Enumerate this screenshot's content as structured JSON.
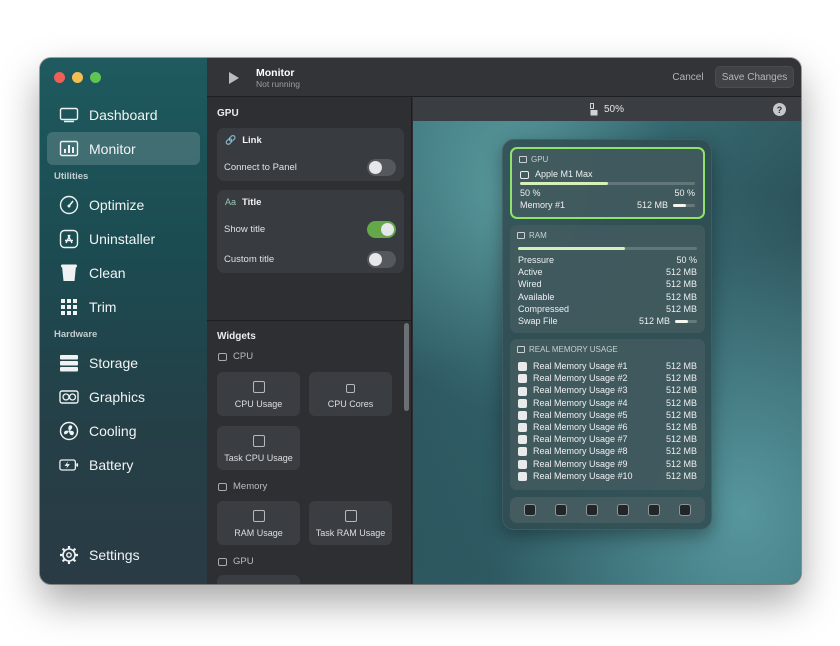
{
  "sidebar": {
    "items": [
      {
        "label": "Dashboard",
        "icon": "display-icon"
      },
      {
        "label": "Monitor",
        "icon": "chart-bars-icon"
      }
    ],
    "utilities_label": "Utilities",
    "utilities": [
      {
        "label": "Optimize",
        "icon": "gauge-icon"
      },
      {
        "label": "Uninstaller",
        "icon": "app-store-icon"
      },
      {
        "label": "Clean",
        "icon": "bin-icon"
      },
      {
        "label": "Trim",
        "icon": "grid-icon"
      }
    ],
    "hardware_label": "Hardware",
    "hardware": [
      {
        "label": "Storage",
        "icon": "storage-icon"
      },
      {
        "label": "Graphics",
        "icon": "gpu-icon"
      },
      {
        "label": "Cooling",
        "icon": "fan-icon"
      },
      {
        "label": "Battery",
        "icon": "battery-icon"
      }
    ],
    "settings": "Settings",
    "active": "Monitor"
  },
  "header": {
    "title": "Monitor",
    "subtitle": "Not running",
    "cancel": "Cancel",
    "save": "Save Changes"
  },
  "config": {
    "section": "GPU",
    "link_card": {
      "title": "Link",
      "row": "Connect to Panel",
      "on": false
    },
    "title_card": {
      "title": "Title",
      "show_title": "Show title",
      "show_on": true,
      "custom_title": "Custom title",
      "custom_on": false
    },
    "widgets_label": "Widgets",
    "cpu_label": "CPU",
    "cpu_tiles": [
      "CPU Usage",
      "CPU Cores",
      "Task CPU Usage"
    ],
    "memory_label": "Memory",
    "memory_tiles": [
      "RAM Usage",
      "Task RAM Usage"
    ],
    "gpu_label": "GPU"
  },
  "preview": {
    "zoom": "50%",
    "gpu_card": {
      "header": "GPU",
      "device": "Apple M1 Max",
      "usage_left": "50 %",
      "usage_right": "50 %",
      "usage_fraction": 0.5,
      "memory_label": "Memory #1",
      "memory_value": "512 MB",
      "memory_fraction": 0.6
    },
    "ram_card": {
      "header": "RAM",
      "bar_fraction": 0.6,
      "rows": [
        {
          "label": "Pressure",
          "value": "50 %"
        },
        {
          "label": "Active",
          "value": "512 MB"
        },
        {
          "label": "Wired",
          "value": "512 MB"
        },
        {
          "label": "Available",
          "value": "512 MB"
        },
        {
          "label": "Compressed",
          "value": "512 MB"
        }
      ],
      "swap_label": "Swap File",
      "swap_value": "512 MB",
      "swap_fraction": 0.6
    },
    "real_card": {
      "header": "REAL MEMORY USAGE",
      "rows": [
        {
          "label": "Real Memory Usage #1",
          "value": "512 MB"
        },
        {
          "label": "Real Memory Usage #2",
          "value": "512 MB"
        },
        {
          "label": "Real Memory Usage #3",
          "value": "512 MB"
        },
        {
          "label": "Real Memory Usage #4",
          "value": "512 MB"
        },
        {
          "label": "Real Memory Usage #5",
          "value": "512 MB"
        },
        {
          "label": "Real Memory Usage #6",
          "value": "512 MB"
        },
        {
          "label": "Real Memory Usage #7",
          "value": "512 MB"
        },
        {
          "label": "Real Memory Usage #8",
          "value": "512 MB"
        },
        {
          "label": "Real Memory Usage #9",
          "value": "512 MB"
        },
        {
          "label": "Real Memory Usage #10",
          "value": "512 MB"
        }
      ]
    },
    "dock_icons": [
      "bolt-icon",
      "terminal-icon",
      "mail-icon",
      "console-icon",
      "lock-icon",
      "gear-icon"
    ]
  },
  "colors": {
    "accent_green": "#8ee36a",
    "toggle_on": "#65a84a"
  }
}
